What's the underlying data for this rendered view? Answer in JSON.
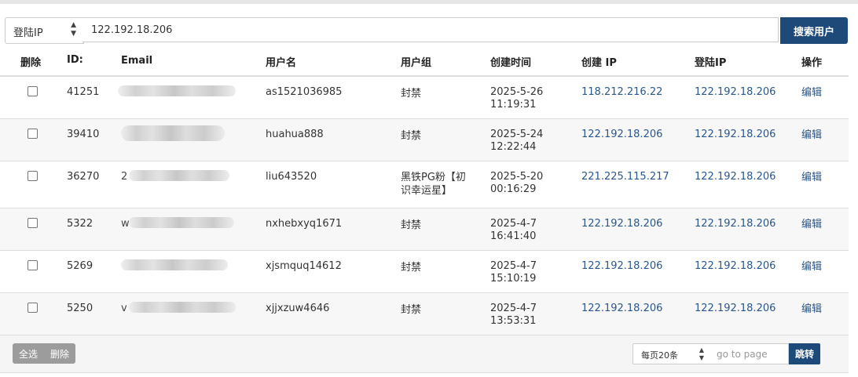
{
  "search": {
    "field_selected": "登陆IP",
    "query": "122.192.18.206",
    "button": "搜索用户"
  },
  "table": {
    "headers": {
      "delete": "删除",
      "id": "ID:",
      "email": "Email",
      "username": "用户名",
      "group": "用户组",
      "created_time": "创建时间",
      "created_ip": "创建 IP",
      "login_ip": "登陆IP",
      "action": "操作"
    },
    "rows": [
      {
        "id": "41251",
        "email_visible": "",
        "username": "as1521036985",
        "group": "封禁",
        "date": "2025-5-26",
        "time": "11:19:31",
        "created_ip": "118.212.216.22",
        "login_ip": "122.192.18.206",
        "action": "编辑"
      },
      {
        "id": "39410",
        "email_visible": "",
        "username": "huahua888",
        "group": "封禁",
        "date": "2025-5-24",
        "time": "12:22:44",
        "created_ip": "122.192.18.206",
        "login_ip": "122.192.18.206",
        "action": "编辑"
      },
      {
        "id": "36270",
        "email_visible": "2",
        "username": "liu643520",
        "group": "黑铁PG粉【初",
        "group2": "识幸运星】",
        "date": "2025-5-20",
        "time": "00:16:29",
        "created_ip": "221.225.115.217",
        "login_ip": "122.192.18.206",
        "action": "编辑"
      },
      {
        "id": "5322",
        "email_visible": "w",
        "username": "nxhebxyq1671",
        "group": "封禁",
        "date": "2025-4-7",
        "time": "16:41:40",
        "created_ip": "122.192.18.206",
        "login_ip": "122.192.18.206",
        "action": "编辑"
      },
      {
        "id": "5269",
        "email_visible": "",
        "username": "xjsmquq14612",
        "group": "封禁",
        "date": "2025-4-7",
        "time": "15:10:19",
        "created_ip": "122.192.18.206",
        "login_ip": "122.192.18.206",
        "action": "编辑"
      },
      {
        "id": "5250",
        "email_visible": "v",
        "username": "xjjxzuw4646",
        "group": "封禁",
        "date": "2025-4-7",
        "time": "13:53:31",
        "created_ip": "122.192.18.206",
        "login_ip": "122.192.18.206",
        "action": "编辑"
      }
    ]
  },
  "footer": {
    "select_all": "全选",
    "delete": "删除",
    "per_page": "每页20条",
    "goto_placeholder": "go to page",
    "jump": "跳转"
  }
}
